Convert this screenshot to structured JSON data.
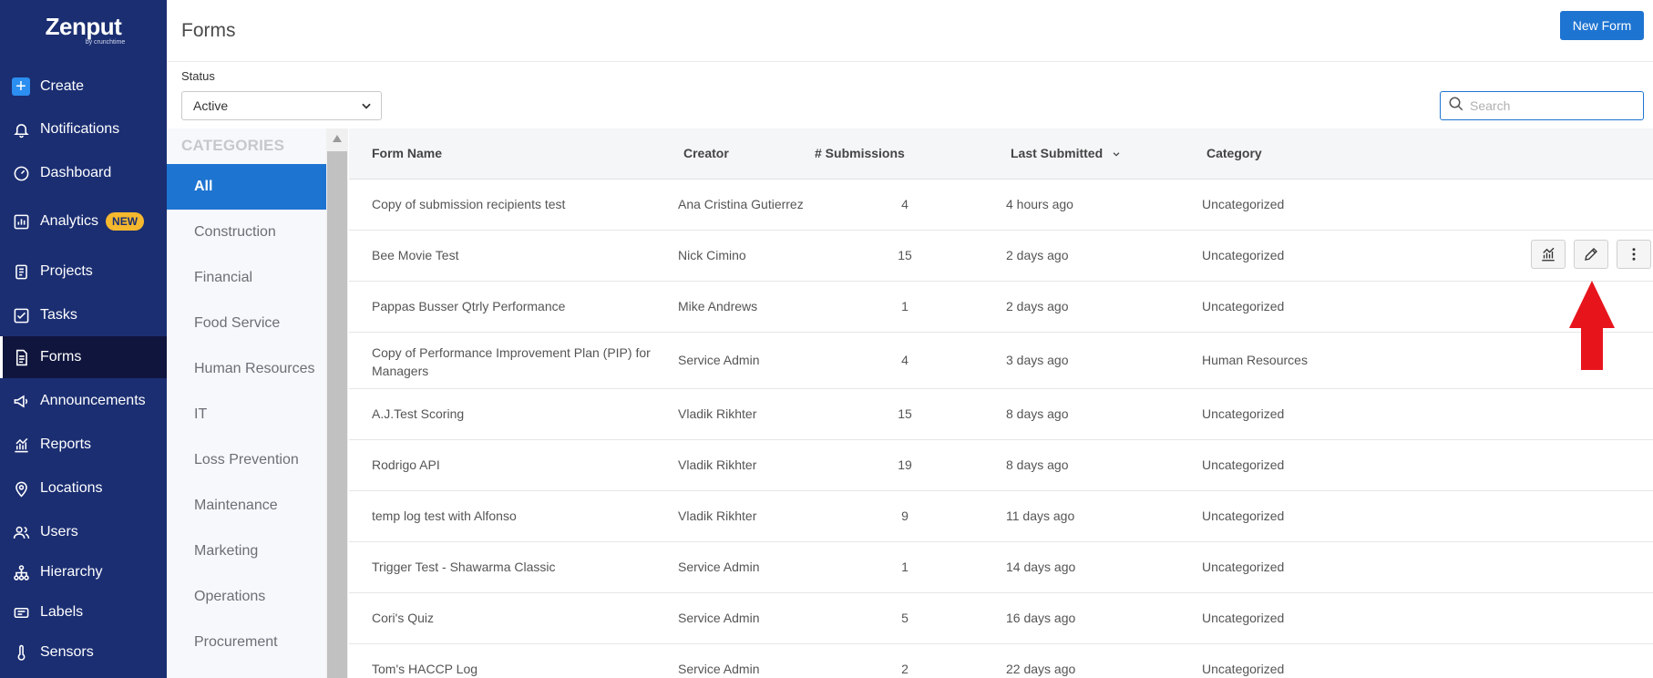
{
  "app": {
    "logo_text": "Zenput",
    "logo_sub": "by crunchtime"
  },
  "sidebar": {
    "items": [
      {
        "label": "Create",
        "icon": "plus-icon"
      },
      {
        "label": "Notifications",
        "icon": "bell-icon"
      },
      {
        "label": "Dashboard",
        "icon": "gauge-icon"
      },
      {
        "label": "Analytics",
        "icon": "chart-icon",
        "badge": "NEW"
      },
      {
        "label": "Projects",
        "icon": "projects-icon"
      },
      {
        "label": "Tasks",
        "icon": "checkbox-icon"
      },
      {
        "label": "Forms",
        "icon": "document-icon",
        "active": true
      },
      {
        "label": "Announcements",
        "icon": "megaphone-icon"
      },
      {
        "label": "Reports",
        "icon": "report-chart-icon"
      },
      {
        "label": "Locations",
        "icon": "map-pin-icon"
      },
      {
        "label": "Users",
        "icon": "users-icon"
      },
      {
        "label": "Hierarchy",
        "icon": "hierarchy-icon"
      },
      {
        "label": "Labels",
        "icon": "label-icon"
      },
      {
        "label": "Sensors",
        "icon": "thermometer-icon"
      }
    ]
  },
  "header": {
    "title": "Forms",
    "new_form_label": "New Form"
  },
  "filters": {
    "status_label": "Status",
    "status_value": "Active",
    "search_placeholder": "Search"
  },
  "categories": {
    "header": "CATEGORIES",
    "items": [
      "All",
      "Construction",
      "Financial",
      "Food Service",
      "Human Resources",
      "IT",
      "Loss Prevention",
      "Maintenance",
      "Marketing",
      "Operations",
      "Procurement"
    ],
    "selected": "All"
  },
  "table": {
    "columns": {
      "name": "Form Name",
      "creator": "Creator",
      "submissions": "# Submissions",
      "last_submitted": "Last Submitted",
      "category": "Category"
    },
    "rows": [
      {
        "name": "Copy of submission recipients test",
        "creator": "Ana Cristina Gutierrez",
        "submissions": "4",
        "last_submitted": "4 hours ago",
        "category": "Uncategorized"
      },
      {
        "name": "Bee Movie Test",
        "creator": "Nick Cimino",
        "submissions": "15",
        "last_submitted": "2 days ago",
        "category": "Uncategorized"
      },
      {
        "name": "Pappas Busser Qtrly Performance",
        "creator": "Mike Andrews",
        "submissions": "1",
        "last_submitted": "2 days ago",
        "category": "Uncategorized"
      },
      {
        "name": "Copy of Performance Improvement Plan (PIP) for",
        "name2": "Managers",
        "creator": "Service Admin",
        "submissions": "4",
        "last_submitted": "3 days ago",
        "category": "Human Resources"
      },
      {
        "name": "A.J.Test Scoring",
        "creator": "Vladik Rikhter",
        "submissions": "15",
        "last_submitted": "8 days ago",
        "category": "Uncategorized"
      },
      {
        "name": "Rodrigo API",
        "creator": "Vladik Rikhter",
        "submissions": "19",
        "last_submitted": "8 days ago",
        "category": "Uncategorized"
      },
      {
        "name": "temp log test with Alfonso",
        "creator": "Vladik Rikhter",
        "submissions": "9",
        "last_submitted": "11 days ago",
        "category": "Uncategorized"
      },
      {
        "name": "Trigger Test - Shawarma Classic",
        "creator": "Service Admin",
        "submissions": "1",
        "last_submitted": "14 days ago",
        "category": "Uncategorized"
      },
      {
        "name": "Cori's Quiz",
        "creator": "Service Admin",
        "submissions": "5",
        "last_submitted": "16 days ago",
        "category": "Uncategorized"
      },
      {
        "name": "Tom's HACCP Log",
        "creator": "Service Admin",
        "submissions": "2",
        "last_submitted": "22 days ago",
        "category": "Uncategorized"
      }
    ],
    "hovered_row_actions": [
      "analytics-icon",
      "pencil-icon",
      "more-vertical-icon"
    ]
  },
  "colors": {
    "sidebar_bg": "#1b2e72",
    "accent": "#1e74d1",
    "badge": "#f5b82e",
    "arrow": "#e8141c"
  }
}
